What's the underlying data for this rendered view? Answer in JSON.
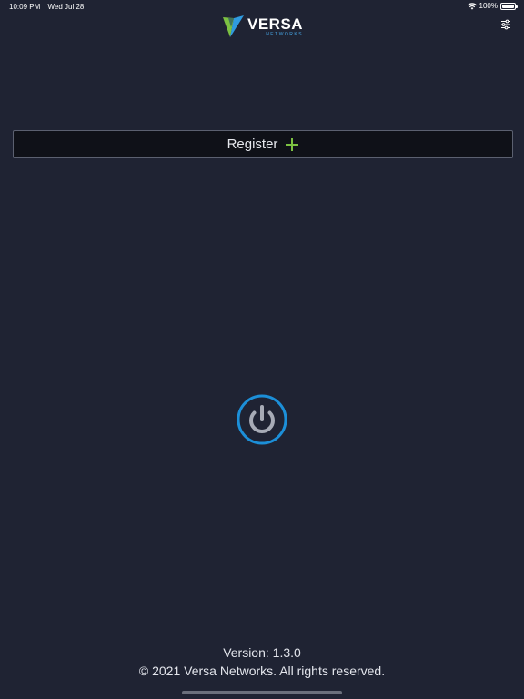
{
  "status_bar": {
    "time": "10:09 PM",
    "date": "Wed Jul 28",
    "battery": "100%",
    "icons": [
      "wifi-icon",
      "battery-icon"
    ]
  },
  "header": {
    "logo_name": "VERSA",
    "logo_sub": "NETWORKS",
    "settings_icon": "sliders-icon"
  },
  "register": {
    "label": "Register",
    "icon": "plus-icon",
    "icon_color": "#7cc142"
  },
  "power": {
    "icon": "power-icon",
    "ring_color": "#1c8fd8"
  },
  "footer": {
    "version": "Version: 1.3.0",
    "copyright": "© 2021 Versa Networks. All rights reserved."
  },
  "colors": {
    "background": "#1f2333",
    "register_bg": "#0f1118",
    "accent_green": "#7cc142",
    "accent_blue": "#1c8fd8"
  }
}
